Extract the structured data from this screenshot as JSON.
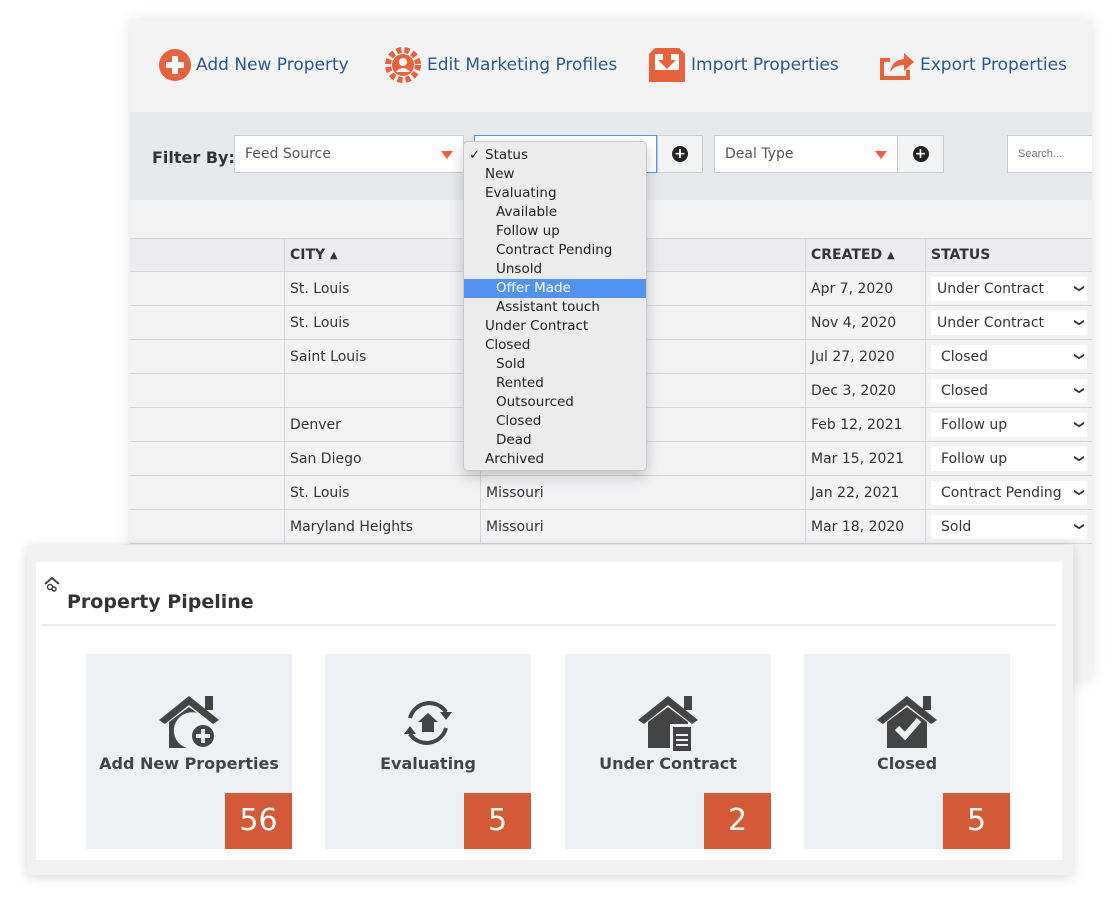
{
  "toolbar": {
    "add": "Add New Property",
    "edit": "Edit Marketing Profiles",
    "import": "Import Properties",
    "export": "Export Properties"
  },
  "filter": {
    "label": "Filter By:",
    "feed_source": "Feed Source",
    "deal_type": "Deal Type",
    "search_placeholder": "Search..."
  },
  "dropdown": {
    "selected": "Status",
    "highlighted": "Offer Made",
    "options": [
      {
        "label": "Status",
        "checked": true
      },
      {
        "label": "New"
      },
      {
        "label": "Evaluating"
      },
      {
        "label": "Available",
        "sub": true
      },
      {
        "label": "Follow up",
        "sub": true
      },
      {
        "label": "Contract Pending",
        "sub": true
      },
      {
        "label": "Unsold",
        "sub": true
      },
      {
        "label": "Offer Made",
        "sub": true
      },
      {
        "label": "Assistant touch",
        "sub": true
      },
      {
        "label": "Under Contract"
      },
      {
        "label": "Closed"
      },
      {
        "label": "Sold",
        "sub": true
      },
      {
        "label": "Rented",
        "sub": true
      },
      {
        "label": "Outsourced",
        "sub": true
      },
      {
        "label": "Closed",
        "sub": true
      },
      {
        "label": "Dead",
        "sub": true
      },
      {
        "label": "Archived"
      }
    ]
  },
  "table": {
    "headers": [
      "",
      "CITY",
      "",
      "CREATED",
      "STATUS"
    ],
    "rows": [
      {
        "city": "St. Louis",
        "state": "",
        "created": "Apr 7, 2020",
        "status": "Under Contract"
      },
      {
        "city": "St. Louis",
        "state": "",
        "created": "Nov 4, 2020",
        "status": "Under Contract"
      },
      {
        "city": "Saint Louis",
        "state": "",
        "created": "Jul 27, 2020",
        "status": "Closed"
      },
      {
        "city": "",
        "state": "",
        "created": "Dec 3, 2020",
        "status": "Closed"
      },
      {
        "city": "Denver",
        "state": "",
        "created": "Feb 12, 2021",
        "status": "Follow up"
      },
      {
        "city": "San Diego",
        "state": "",
        "created": "Mar 15, 2021",
        "status": "Follow up"
      },
      {
        "city": "St. Louis",
        "state": "Missouri",
        "created": "Jan 22, 2021",
        "status": "Contract Pending"
      },
      {
        "city": "Maryland Heights",
        "state": "Missouri",
        "created": "Mar 18, 2020",
        "status": "Sold"
      }
    ]
  },
  "pipeline": {
    "title": "Property Pipeline",
    "tiles": [
      {
        "label": "Add New Properties",
        "count": "56",
        "icon": "house-plus-icon"
      },
      {
        "label": "Evaluating",
        "count": "5",
        "icon": "house-cycle-icon"
      },
      {
        "label": "Under Contract",
        "count": "2",
        "icon": "house-document-icon"
      },
      {
        "label": "Closed",
        "count": "5",
        "icon": "house-check-icon"
      }
    ]
  },
  "colors": {
    "accent": "#e8623c",
    "link": "#2a5a8c",
    "count_bg": "#d45936",
    "highlight": "#5093f0"
  }
}
